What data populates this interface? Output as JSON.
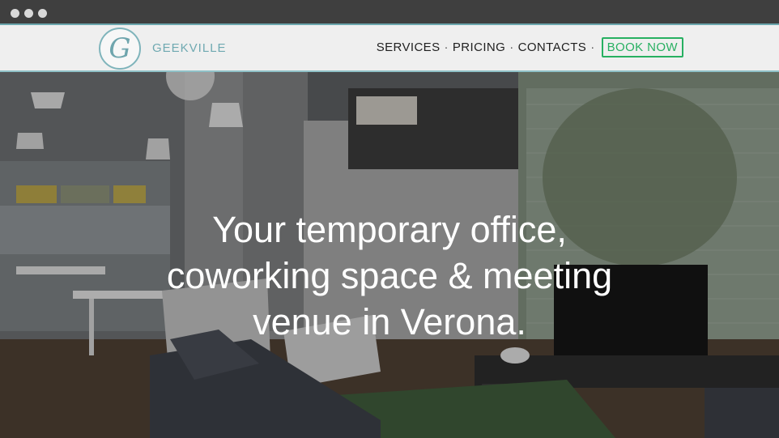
{
  "window": {
    "controls": [
      "close-dot",
      "minimize-dot",
      "maximize-dot"
    ]
  },
  "header": {
    "logo_letter": "G",
    "brand": "GEEKVILLE",
    "nav": {
      "services": "SERVICES",
      "pricing": "PRICING",
      "contacts": "CONTACTS",
      "separator": "·",
      "book_now": "BOOK NOW"
    }
  },
  "hero": {
    "headline_lines": [
      "Your temporary office,",
      "coworking space & meeting",
      "venue in Verona."
    ]
  },
  "colors": {
    "accent_teal": "#6fa9b1",
    "book_green": "#27b061",
    "titlebar": "#3f3f3f"
  }
}
